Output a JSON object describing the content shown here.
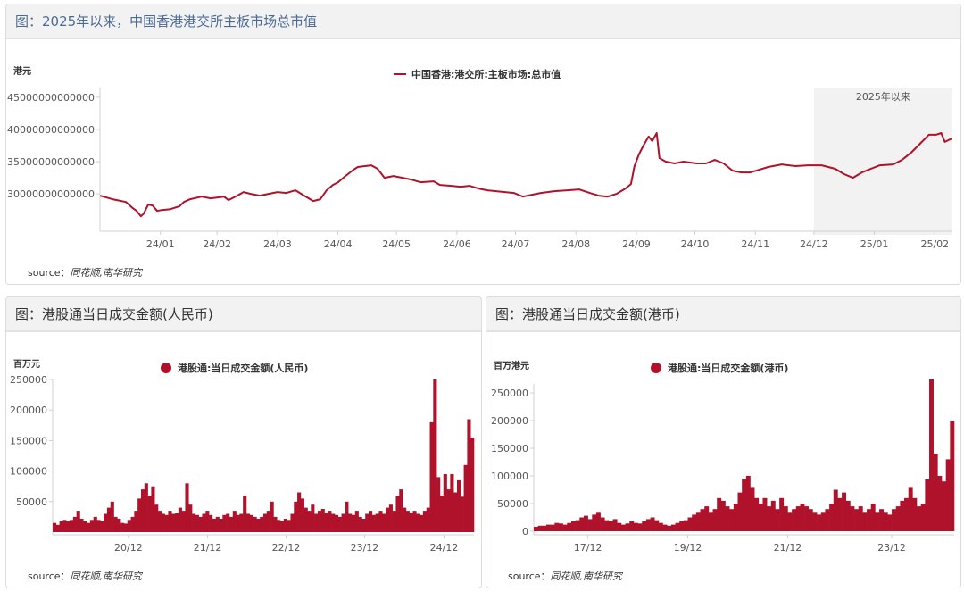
{
  "colors": {
    "series": "#b0122b",
    "shade": "#f2f2f2",
    "axis": "#d0d0d0"
  },
  "chart_data": [
    {
      "type": "line",
      "title": "图：2025年以来，中国香港港交所主板市场总市值",
      "ylabel": "港元",
      "legend": "中国香港港交所主板市场总市值",
      "legend_text": "中国香港:港交所:主板市场:总市值",
      "legend_position": "top-center",
      "x_unit": "days since 2023-12-01",
      "y_scale": 1000000000000,
      "ylim": [
        24.2,
        46.5
      ],
      "xlim": [
        0,
        437
      ],
      "yticks": [
        {
          "v": 30,
          "label": "30000000000000"
        },
        {
          "v": 35,
          "label": "35000000000000"
        },
        {
          "v": 40,
          "label": "40000000000000"
        },
        {
          "v": 45,
          "label": "45000000000000"
        }
      ],
      "xticks": [
        {
          "v": 31,
          "label": "24/01"
        },
        {
          "v": 60,
          "label": "24/02"
        },
        {
          "v": 91,
          "label": "24/03"
        },
        {
          "v": 122,
          "label": "24/04"
        },
        {
          "v": 152,
          "label": "24/05"
        },
        {
          "v": 183,
          "label": "24/06"
        },
        {
          "v": 213,
          "label": "24/07"
        },
        {
          "v": 244,
          "label": "24/08"
        },
        {
          "v": 275,
          "label": "24/09"
        },
        {
          "v": 305,
          "label": "24/10"
        },
        {
          "v": 336,
          "label": "24/11"
        },
        {
          "v": 366,
          "label": "24/12"
        },
        {
          "v": 397,
          "label": "25/01"
        },
        {
          "v": 428,
          "label": "25/02"
        }
      ],
      "highlight": {
        "from": 366,
        "to": 437,
        "label": "2025年以来"
      },
      "points": [
        [
          0,
          29.72
        ],
        [
          6.4,
          29.17
        ],
        [
          13.3,
          28.75
        ],
        [
          16.9,
          27.78
        ],
        [
          18.8,
          27.36
        ],
        [
          21,
          26.53
        ],
        [
          22.4,
          26.94
        ],
        [
          24.7,
          28.33
        ],
        [
          27,
          28.19
        ],
        [
          29.3,
          27.36
        ],
        [
          31.6,
          27.5
        ],
        [
          36.1,
          27.64
        ],
        [
          40.7,
          28.06
        ],
        [
          43,
          28.75
        ],
        [
          46.2,
          29.17
        ],
        [
          52.1,
          29.58
        ],
        [
          56.7,
          29.31
        ],
        [
          63.6,
          29.58
        ],
        [
          65.9,
          29.03
        ],
        [
          70.4,
          29.72
        ],
        [
          73.6,
          30.28
        ],
        [
          77.3,
          30
        ],
        [
          81.9,
          29.72
        ],
        [
          86.4,
          30
        ],
        [
          91,
          30.28
        ],
        [
          95.6,
          30.14
        ],
        [
          100.2,
          30.56
        ],
        [
          104.7,
          29.72
        ],
        [
          109.3,
          28.89
        ],
        [
          113,
          29.17
        ],
        [
          116.2,
          30.56
        ],
        [
          119.4,
          31.39
        ],
        [
          122.1,
          31.81
        ],
        [
          125.3,
          32.64
        ],
        [
          129.9,
          33.75
        ],
        [
          132.2,
          34.17
        ],
        [
          139.1,
          34.44
        ],
        [
          142.3,
          33.89
        ],
        [
          145.9,
          32.5
        ],
        [
          150.5,
          32.78
        ],
        [
          155.1,
          32.5
        ],
        [
          159.6,
          32.22
        ],
        [
          164.2,
          31.81
        ],
        [
          171.1,
          31.94
        ],
        [
          174.3,
          31.39
        ],
        [
          180.2,
          31.25
        ],
        [
          184.8,
          31.11
        ],
        [
          189.4,
          31.25
        ],
        [
          194,
          30.83
        ],
        [
          198.5,
          30.56
        ],
        [
          203.1,
          30.42
        ],
        [
          207.7,
          30.28
        ],
        [
          212.2,
          30.14
        ],
        [
          216.8,
          29.58
        ],
        [
          221.4,
          29.86
        ],
        [
          226,
          30.14
        ],
        [
          232.8,
          30.42
        ],
        [
          239.7,
          30.56
        ],
        [
          245.6,
          30.69
        ],
        [
          251.1,
          30.14
        ],
        [
          255.7,
          29.72
        ],
        [
          260.3,
          29.58
        ],
        [
          264.8,
          30
        ],
        [
          269.4,
          30.83
        ],
        [
          272.2,
          31.53
        ],
        [
          274,
          34.31
        ],
        [
          276.3,
          36.11
        ],
        [
          278.6,
          37.5
        ],
        [
          281.3,
          38.89
        ],
        [
          283.1,
          38.19
        ],
        [
          285.4,
          39.44
        ],
        [
          286.8,
          35.56
        ],
        [
          290,
          35
        ],
        [
          294.6,
          34.72
        ],
        [
          299.1,
          35
        ],
        [
          306,
          34.72
        ],
        [
          310.6,
          34.72
        ],
        [
          315.2,
          35.28
        ],
        [
          319.7,
          34.72
        ],
        [
          324.3,
          33.61
        ],
        [
          328.9,
          33.33
        ],
        [
          333.4,
          33.33
        ],
        [
          338,
          33.75
        ],
        [
          342.6,
          34.17
        ],
        [
          349.5,
          34.58
        ],
        [
          356.3,
          34.31
        ],
        [
          363.2,
          34.44
        ],
        [
          370,
          34.44
        ],
        [
          376.9,
          33.89
        ],
        [
          381.5,
          33.06
        ],
        [
          386,
          32.5
        ],
        [
          390.6,
          33.33
        ],
        [
          395.2,
          33.89
        ],
        [
          399.8,
          34.44
        ],
        [
          406.6,
          34.58
        ],
        [
          411.2,
          35.28
        ],
        [
          415.8,
          36.39
        ],
        [
          420.4,
          37.78
        ],
        [
          424.9,
          39.17
        ],
        [
          428.6,
          39.17
        ],
        [
          431.3,
          39.44
        ],
        [
          433.1,
          38.06
        ],
        [
          436.8,
          38.61
        ]
      ],
      "source_label": "source：",
      "source": "同花顺,南华研究"
    },
    {
      "type": "bar",
      "title": "图：港股通当日成交金额(人民币)",
      "ylabel": "百万元",
      "legend": "港股通:当日成交金额(人民币)",
      "legend_position": "top-center",
      "x_unit": "half-month periods from 2020-01",
      "ylim": [
        0,
        250000
      ],
      "yticks": [
        {
          "v": 50000,
          "label": "50000"
        },
        {
          "v": 100000,
          "label": "100000"
        },
        {
          "v": 150000,
          "label": "150000"
        },
        {
          "v": 200000,
          "label": "200000"
        },
        {
          "v": 250000,
          "label": "250000"
        }
      ],
      "xticks": [
        {
          "v": 22.3,
          "label": "20/12"
        },
        {
          "v": 45.6,
          "label": "21/12"
        },
        {
          "v": 68.7,
          "label": "22/12"
        },
        {
          "v": 91.8,
          "label": "23/12"
        },
        {
          "v": 115.2,
          "label": "24/12"
        }
      ],
      "values": [
        15000,
        12000,
        18000,
        20000,
        18000,
        20000,
        25000,
        35000,
        22000,
        18000,
        15000,
        20000,
        25000,
        20000,
        18000,
        30000,
        40000,
        50000,
        25000,
        22000,
        15000,
        14000,
        20000,
        25000,
        35000,
        55000,
        70000,
        80000,
        60000,
        75000,
        45000,
        35000,
        30000,
        28000,
        35000,
        30000,
        32000,
        40000,
        35000,
        80000,
        45000,
        30000,
        28000,
        25000,
        30000,
        35000,
        28000,
        22000,
        25000,
        22000,
        28000,
        30000,
        25000,
        35000,
        28000,
        30000,
        60000,
        30000,
        28000,
        25000,
        22000,
        25000,
        30000,
        35000,
        50000,
        25000,
        20000,
        18000,
        22000,
        20000,
        30000,
        50000,
        65000,
        55000,
        40000,
        35000,
        45000,
        30000,
        35000,
        38000,
        32000,
        35000,
        30000,
        28000,
        25000,
        30000,
        50000,
        30000,
        28000,
        35000,
        25000,
        22000,
        30000,
        35000,
        28000,
        30000,
        35000,
        30000,
        40000,
        45000,
        35000,
        60000,
        70000,
        40000,
        35000,
        32000,
        35000,
        30000,
        28000,
        35000,
        40000,
        180000,
        250000,
        90000,
        60000,
        95000,
        70000,
        95000,
        65000,
        85000,
        58000,
        110000,
        185000,
        155000
      ],
      "source_label": "source：",
      "source": "同花顺,南华研究"
    },
    {
      "type": "bar",
      "title": "图：港股通当日成交金额(港币)",
      "ylabel": "百万港元",
      "legend": "港股通:当日成交金额(港币)",
      "legend_position": "top-center",
      "x_unit": "months from 2016-11",
      "ylim": [
        0,
        250000
      ],
      "yticks": [
        {
          "v": 0,
          "label": "0"
        },
        {
          "v": 50000,
          "label": "50000"
        },
        {
          "v": 100000,
          "label": "100000"
        },
        {
          "v": 150000,
          "label": "150000"
        },
        {
          "v": 200000,
          "label": "200000"
        },
        {
          "v": 250000,
          "label": "250000"
        }
      ],
      "xticks": [
        {
          "v": 13,
          "label": "17/12"
        },
        {
          "v": 37,
          "label": "19/12"
        },
        {
          "v": 61,
          "label": "21/12"
        },
        {
          "v": 86,
          "label": "23/12"
        }
      ],
      "values": [
        8000,
        10000,
        10000,
        12000,
        12000,
        15000,
        14000,
        12000,
        15000,
        18000,
        20000,
        25000,
        28000,
        22000,
        30000,
        35000,
        25000,
        20000,
        18000,
        22000,
        15000,
        12000,
        14000,
        18000,
        15000,
        14000,
        18000,
        22000,
        25000,
        20000,
        15000,
        12000,
        10000,
        12000,
        15000,
        18000,
        20000,
        25000,
        30000,
        35000,
        40000,
        45000,
        35000,
        40000,
        60000,
        55000,
        45000,
        40000,
        50000,
        70000,
        95000,
        100000,
        80000,
        60000,
        50000,
        60000,
        45000,
        55000,
        40000,
        60000,
        45000,
        35000,
        40000,
        45000,
        50000,
        45000,
        40000,
        35000,
        30000,
        35000,
        40000,
        50000,
        75000,
        60000,
        70000,
        55000,
        45000,
        40000,
        45000,
        35000,
        40000,
        50000,
        35000,
        40000,
        35000,
        30000,
        40000,
        45000,
        55000,
        60000,
        80000,
        60000,
        45000,
        50000,
        95000,
        275000,
        140000,
        100000,
        90000,
        130000,
        200000
      ],
      "source_label": "source：",
      "source": "同花顺,南华研究"
    }
  ]
}
